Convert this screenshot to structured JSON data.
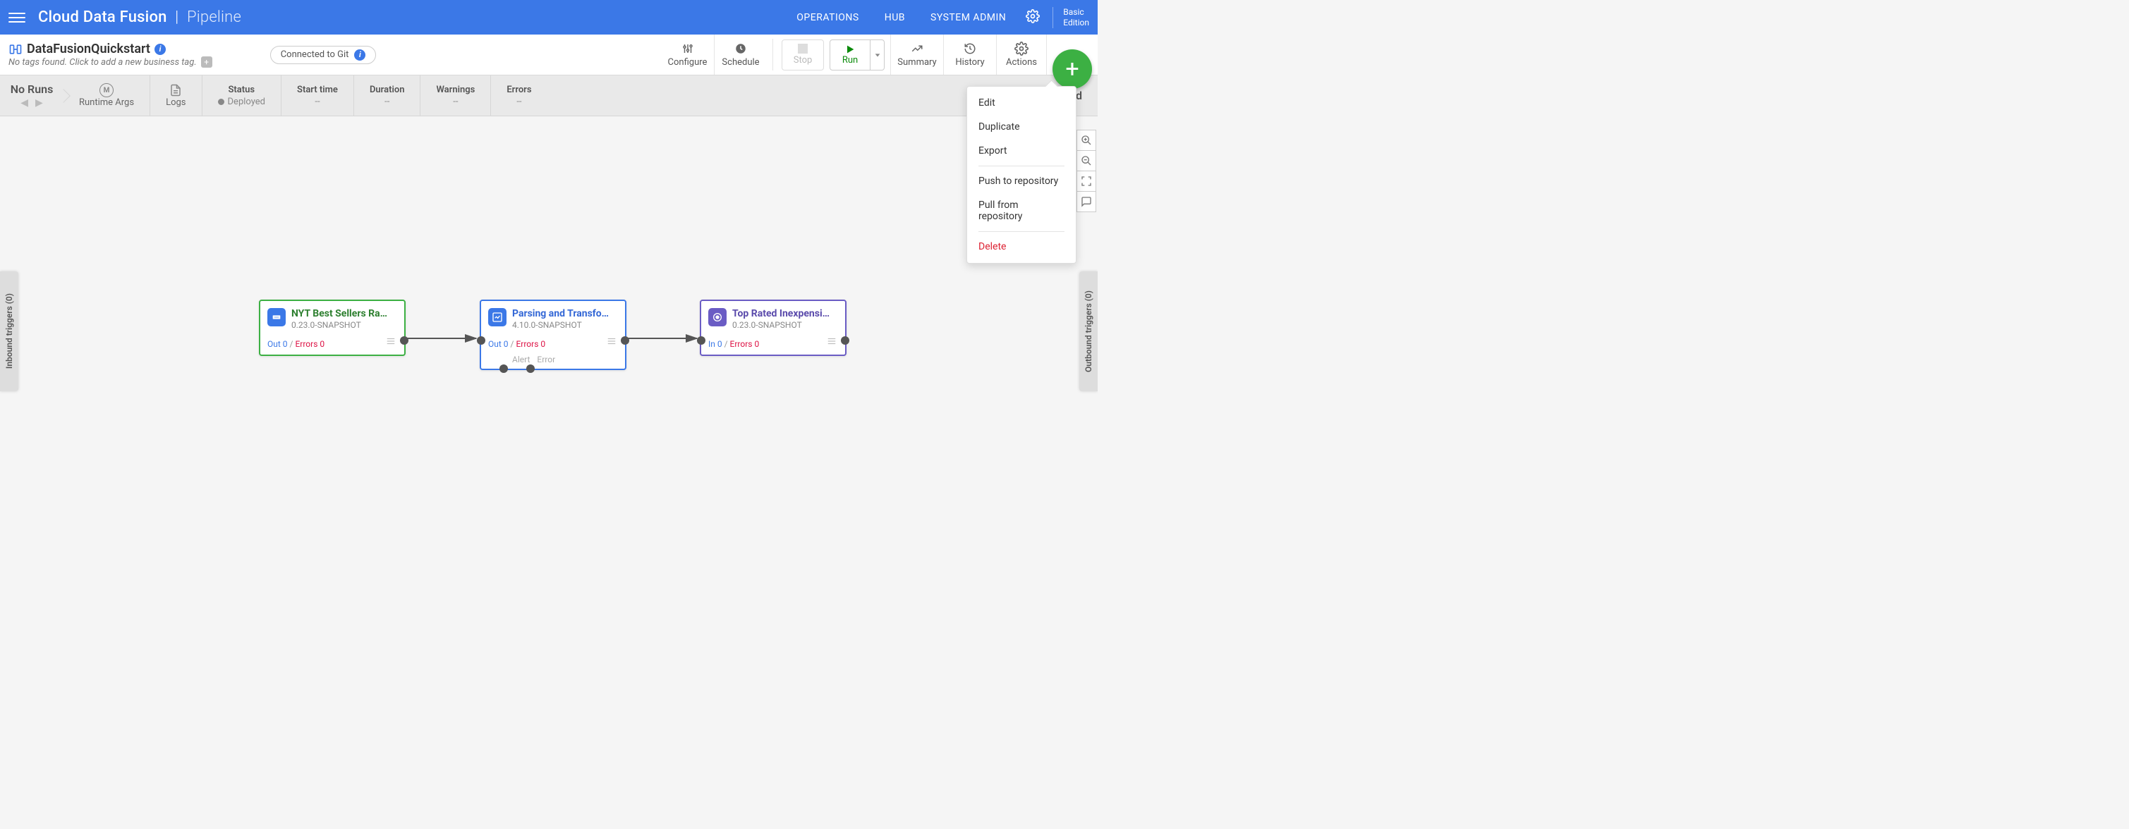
{
  "header": {
    "brand_main": "Cloud Data Fusion",
    "brand_pipe": "|",
    "brand_sub": "Pipeline",
    "links": {
      "operations": "OPERATIONS",
      "hub": "HUB",
      "sysadmin": "SYSTEM ADMIN"
    },
    "edition_line1": "Basic",
    "edition_line2": "Edition"
  },
  "pipeline": {
    "name": "DataFusionQuickstart",
    "tags_placeholder": "No tags found. Click to add a new business tag.",
    "git_status": "Connected to Git"
  },
  "actions": {
    "configure": "Configure",
    "schedule": "Schedule",
    "stop": "Stop",
    "run": "Run",
    "summary": "Summary",
    "history": "History",
    "actions": "Actions"
  },
  "statusbar": {
    "no_runs": "No Runs",
    "runtime_args": "Runtime Args",
    "logs": "Logs",
    "status_label": "Status",
    "status_value": "Deployed",
    "start_label": "Start time",
    "start_value": "--",
    "duration_label": "Duration",
    "duration_value": "--",
    "warnings_label": "Warnings",
    "warnings_value": "--",
    "errors_label": "Errors",
    "errors_value": "--",
    "completed": "Completed"
  },
  "side_tabs": {
    "inbound": "Inbound triggers (0)",
    "outbound": "Outbound triggers (0)"
  },
  "dropdown": {
    "edit": "Edit",
    "duplicate": "Duplicate",
    "export": "Export",
    "push": "Push to repository",
    "pull": "Pull from repository",
    "delete": "Delete"
  },
  "nodes": {
    "n1": {
      "title": "NYT Best Sellers Ra…",
      "version": "0.23.0-SNAPSHOT",
      "out": "Out 0",
      "sep": "/",
      "err": "Errors 0"
    },
    "n2": {
      "title": "Parsing and Transfo…",
      "version": "4.10.0-SNAPSHOT",
      "out": "Out 0",
      "sep": "/",
      "err": "Errors 0",
      "alert": "Alert",
      "error": "Error"
    },
    "n3": {
      "title": "Top Rated Inexpensi…",
      "version": "0.23.0-SNAPSHOT",
      "in": "In 0",
      "sep": "/",
      "err": "Errors 0"
    }
  }
}
